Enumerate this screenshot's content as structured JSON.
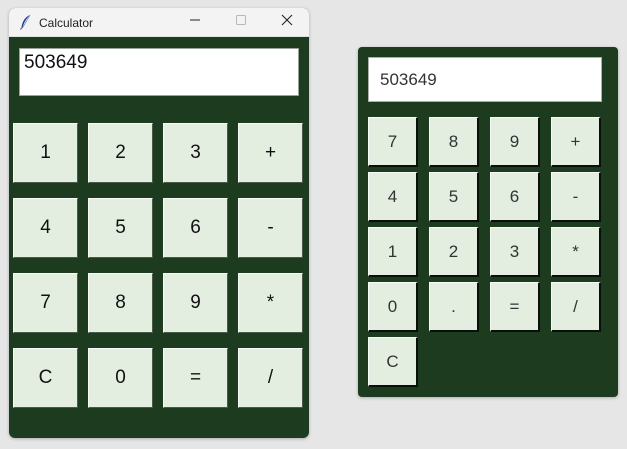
{
  "colors": {
    "desktop_bg": "#e6e6e6",
    "window_bg": "#1c3b1f",
    "button_bg": "#e3eee0",
    "display_bg": "#ffffff",
    "titlebar_bg": "#f3f3f3"
  },
  "left_window": {
    "title": "Calculator",
    "app_icon": "feather-icon",
    "controls": {
      "minimize_icon": "minimize-icon",
      "maximize_icon": "maximize-icon",
      "close_icon": "close-icon"
    },
    "display_value": "503649",
    "buttons": [
      [
        "1",
        "2",
        "3",
        "+"
      ],
      [
        "4",
        "5",
        "6",
        "-"
      ],
      [
        "7",
        "8",
        "9",
        "*"
      ],
      [
        "C",
        "0",
        "=",
        "/"
      ]
    ]
  },
  "right_panel": {
    "display_value": "503649",
    "buttons": [
      [
        "7",
        "8",
        "9",
        "+"
      ],
      [
        "4",
        "5",
        "6",
        "-"
      ],
      [
        "1",
        "2",
        "3",
        "*"
      ],
      [
        "0",
        ".",
        "=",
        "/"
      ],
      [
        "C"
      ]
    ]
  }
}
